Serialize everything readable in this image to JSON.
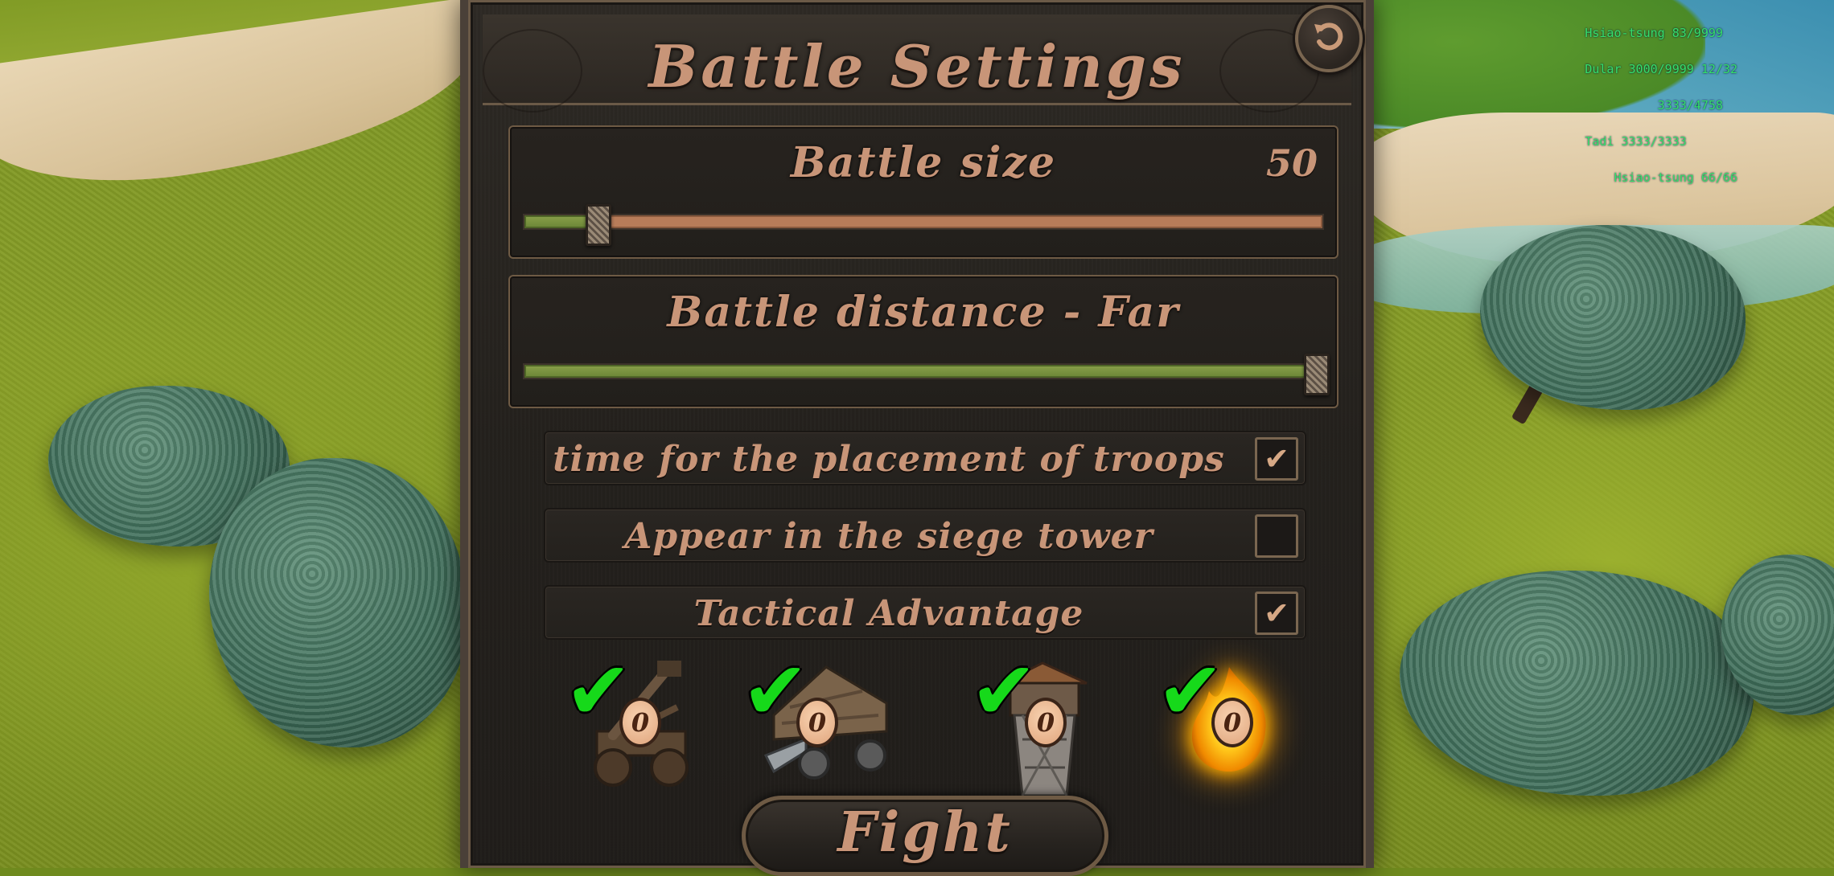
{
  "hud": {
    "lines": [
      "Hsiao-tsung 83/9999",
      "Dular 3000/9999 12/32",
      "          3333/4758",
      "Tadi 3333/3333",
      "    Hsiao-tsung 66/66"
    ]
  },
  "dialog": {
    "title": "Battle Settings",
    "back_icon": "undo-arrow-icon"
  },
  "battle_size": {
    "label": "Battle size",
    "value": "50",
    "slider_fraction": 0.09
  },
  "battle_distance": {
    "label": "Battle distance - Far",
    "slider_fraction": 0.99
  },
  "options": [
    {
      "label": "time for the placement of troops",
      "checked": true
    },
    {
      "label": "Appear in the siege tower",
      "checked": false
    },
    {
      "label": "Tactical Advantage",
      "checked": true
    }
  ],
  "checkbox_mark": "✔",
  "siege_weapons": [
    {
      "name": "catapult",
      "icon": "catapult-icon",
      "enabled": true,
      "count": "0"
    },
    {
      "name": "battering ram",
      "icon": "battering-ram-icon",
      "enabled": true,
      "count": "0"
    },
    {
      "name": "siege tower",
      "icon": "siege-tower-icon",
      "enabled": true,
      "count": "0"
    },
    {
      "name": "fire",
      "icon": "fire-icon",
      "enabled": true,
      "count": "0"
    }
  ],
  "siege_check_mark": "✔",
  "fight_button": {
    "label": "Fight"
  },
  "colors": {
    "text_accent": "#c89578",
    "slider_fill": "#6a8536",
    "slider_track": "#b87c59",
    "check_green": "#16d91a"
  }
}
